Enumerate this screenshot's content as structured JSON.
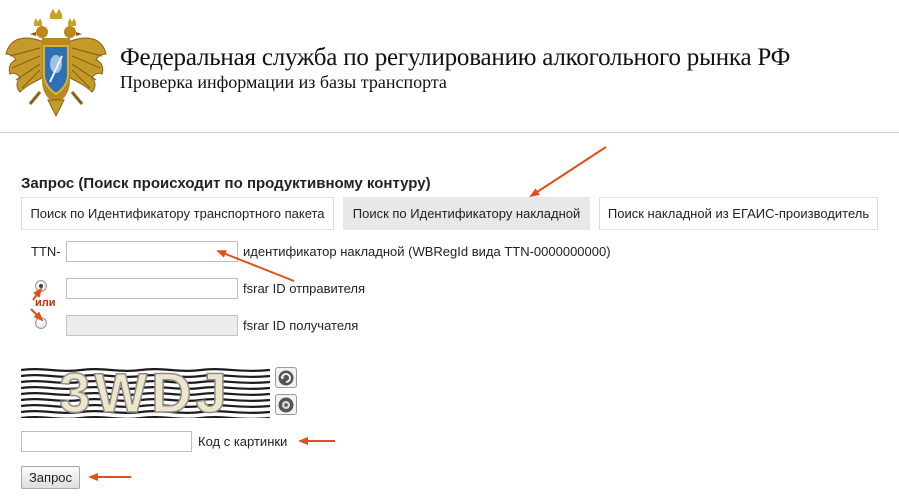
{
  "header": {
    "title": "Федеральная служба по регулированию алкогольного рынка РФ",
    "subtitle": "Проверка информации из базы транспорта",
    "emblem_icon": "double-headed-eagle-emblem"
  },
  "request": {
    "title": "Запрос (Поиск происходит по продуктивному контуру)",
    "tabs": [
      {
        "label": "Поиск по Идентификатору транспортного пакета",
        "active": false
      },
      {
        "label": "Поиск по Идентификатору накладной",
        "active": true
      },
      {
        "label": "Поиск накладной из ЕГАИС-производитель",
        "active": false
      }
    ]
  },
  "form": {
    "ttn_prefix": "TTN-",
    "ttn_value": "",
    "ttn_hint": "идентификатор накладной (WBRegId вида TTN-0000000000)",
    "or_label": "или",
    "sender_label": "fsrar ID отправителя",
    "sender_value": "",
    "sender_selected": true,
    "receiver_label": "fsrar ID получателя",
    "receiver_value": "",
    "receiver_selected": false,
    "captcha_text": "3WDJ",
    "captcha_refresh_icon": "refresh-icon",
    "captcha_audio_icon": "audio-icon",
    "captcha_code_label": "Код с картинки",
    "captcha_code_value": "",
    "submit_label": "Запрос"
  },
  "colors": {
    "annotation_arrow": "#e0501b",
    "active_tab_bg": "#e6e8e9",
    "or_label": "#cc2a00"
  }
}
